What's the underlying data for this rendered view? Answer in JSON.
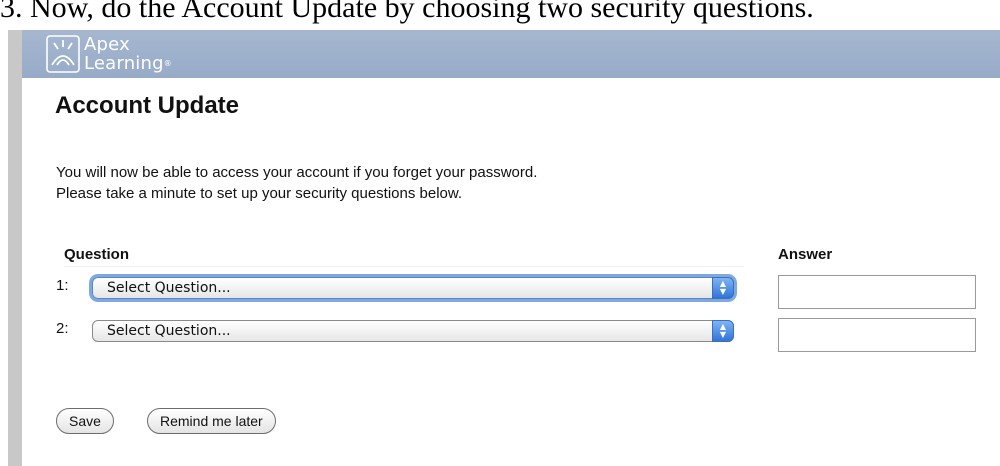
{
  "caption": "3. Now, do the Account Update by choosing two security questions.",
  "header": {
    "logo_line1": "Apex",
    "logo_line2": "Learning",
    "logo_mark": "®",
    "logo_icon": "apex-learning-logo-icon"
  },
  "page": {
    "title": "Account Update",
    "intro_line1": "You will now be able to access your account if you forget your password.",
    "intro_line2": "Please take a minute to set up your security questions below."
  },
  "form": {
    "question_header": "Question",
    "answer_header": "Answer",
    "rows": [
      {
        "number": "1:",
        "selected": "Select Question...",
        "answer": ""
      },
      {
        "number": "2:",
        "selected": "Select Question...",
        "answer": ""
      }
    ]
  },
  "buttons": {
    "save": "Save",
    "remind": "Remind me later"
  },
  "colors": {
    "header_bg": "#9fb2cc",
    "focus_ring": "#7fa8e0",
    "stepper": "#2f74d8"
  }
}
